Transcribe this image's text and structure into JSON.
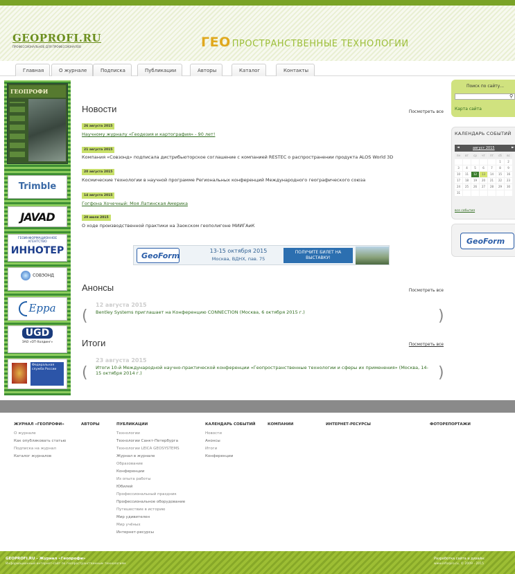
{
  "header": {
    "logo_text": "GEOPROFI.RU",
    "logo_tagline": "ПРОФЕССИОНАЛЬНОЕ ДЛЯ ПРОФЕССИОНАЛОВ",
    "slogan_prefix": "ГЕО",
    "slogan_rest": "ПРОСТРАНСТВЕННЫЕ ТЕХНОЛОГИИ"
  },
  "nav": {
    "tabs": [
      "Главная",
      "О журнале",
      "Подписка",
      "Публикации",
      "Авторы",
      "Каталог",
      "Контакты"
    ]
  },
  "sidebar": {
    "cover_title": "ГЕОПРОФИ",
    "banners": {
      "trimble": "Trimble",
      "javad": "JAVAD",
      "innoter_small": "ГЕОИНФОРМАЦИОННОЕ АГЕНТСТВО",
      "innoter_big": "ИННОТЕР",
      "sovzond": "СОВЗОНД",
      "geppa": "Ерра",
      "ugd": "UGD",
      "ugd_sub": "ЗАО «ОТ-Холдинг»",
      "gov": "Федеральная служба России"
    }
  },
  "main": {
    "news": {
      "title": "Новости",
      "see_all": "Посмотреть все",
      "items": [
        {
          "date": "26 августа 2015",
          "title": "Научному журналу «Геодезия и картография» - 90 лет!",
          "link": true
        },
        {
          "date": "21 августа 2015",
          "title": "Компания «Совзонд» подписала дистрибьюторское соглашение с компанией RESTEC о распространении продукта ALOS World 3D",
          "link": false
        },
        {
          "date": "20 августа 2015",
          "title": "Космические технологии в научной программе Региональных конференций Международного географического союза",
          "link": false
        },
        {
          "date": "14 августа 2015",
          "title": "Гогфона Хочечный: Моя Латинская Америка",
          "link": true
        },
        {
          "date": "20 июля 2015",
          "title": "О ходе производственной практики на Заокском геополигоне МИИГАиК",
          "link": false
        }
      ]
    },
    "ad": {
      "logo": "GeoForm",
      "date": "13-15 октября 2015",
      "place": "Москва, ВДНХ, пав. 75",
      "cta": "ПОЛУЧИТЕ БИЛЕТ НА ВЫСТАВКУ!"
    },
    "announcements": {
      "title": "Анонсы",
      "see_all": "Посмотреть все",
      "date": "12 августа 2015",
      "text": "Bentley Systems приглашает на Конференцию CONNECTION (Москва, 6 октября 2015 г.)"
    },
    "results": {
      "title": "Итоги",
      "see_all": "Посмотреть все",
      "date": "23 августа 2015",
      "text": "Итоги 10-й Международной научно-практической конференции «Геопространственные технологии и сферы их применения» (Москва, 14-15 октября 2014 г.)"
    },
    "arrows": {
      "left": "(",
      "right": ")"
    }
  },
  "right": {
    "search_label": "Поиск по сайту...",
    "search_placeholder": "",
    "search_link": "Карта сайта",
    "calendar_title": "КАЛЕНДАРЬ СОБЫТИЙ",
    "calendar_month": "август 2015",
    "calendar_prev": "◄",
    "calendar_next": "►",
    "calendar_days": [
      "пн",
      "вт",
      "ср",
      "чт",
      "пт",
      "сб",
      "вс"
    ],
    "calendar_weeks": [
      [
        "",
        "",
        "",
        "",
        "",
        "1",
        "2"
      ],
      [
        "3",
        "4",
        "5",
        "6",
        "7",
        "8",
        "9"
      ],
      [
        "10",
        "11",
        "12",
        "13",
        "14",
        "15",
        "16"
      ],
      [
        "17",
        "18",
        "19",
        "20",
        "21",
        "22",
        "23"
      ],
      [
        "24",
        "25",
        "26",
        "27",
        "28",
        "29",
        "30"
      ],
      [
        "31",
        "",
        "",
        "",
        "",
        "",
        ""
      ]
    ],
    "calendar_all": "все события",
    "geoform_logo": "GeoForm"
  },
  "footer": {
    "columns": [
      {
        "head": "ЖУРНАЛ «ГЕОПРОФИ»",
        "items": [
          "О журнале",
          "Как опубликовать статью",
          "Подписка на журнал",
          "Каталог журналов"
        ]
      },
      {
        "head": "АВТОРЫ",
        "items": []
      },
      {
        "head": "ПУБЛИКАЦИИ",
        "items": [
          "Технологии",
          "Технологии Санкт-Петербурга",
          "Технологии LEICA GEOSYSTEMS",
          "Журнал в журнале",
          "Образование",
          "Конференции",
          "Из опыта работы",
          "Юбилей",
          "Профессиональный праздник",
          "Профессиональное оборудование",
          "Путешествие в историю",
          "Мир удивителен",
          "Мир учёных",
          "Интернет-ресурсы"
        ]
      },
      {
        "head": "КАЛЕНДАРЬ СОБЫТИЙ",
        "items": [
          "Новости",
          "Анонсы",
          "Итоги",
          "Конференции"
        ]
      },
      {
        "head": "КОМПАНИИ",
        "items": []
      },
      {
        "head": "ИНТЕРНЕТ-РЕСУРСЫ",
        "items": []
      },
      {
        "head": "ФОТОРЕПОРТАЖИ",
        "items": []
      }
    ],
    "copy1": "GEOPROFI.RU - Журнал «Геопрофи»",
    "copy2": "Информационный интернет-сайт по геопространственным технологиям",
    "dev1": "Разработка сайта и дизайн:",
    "dev2": "www.inforpro.ru, © 2009 - 2015"
  },
  "colors": {
    "accent": "#7aa326",
    "link": "#2f6b1e",
    "date_bg": "#c8e06a"
  }
}
